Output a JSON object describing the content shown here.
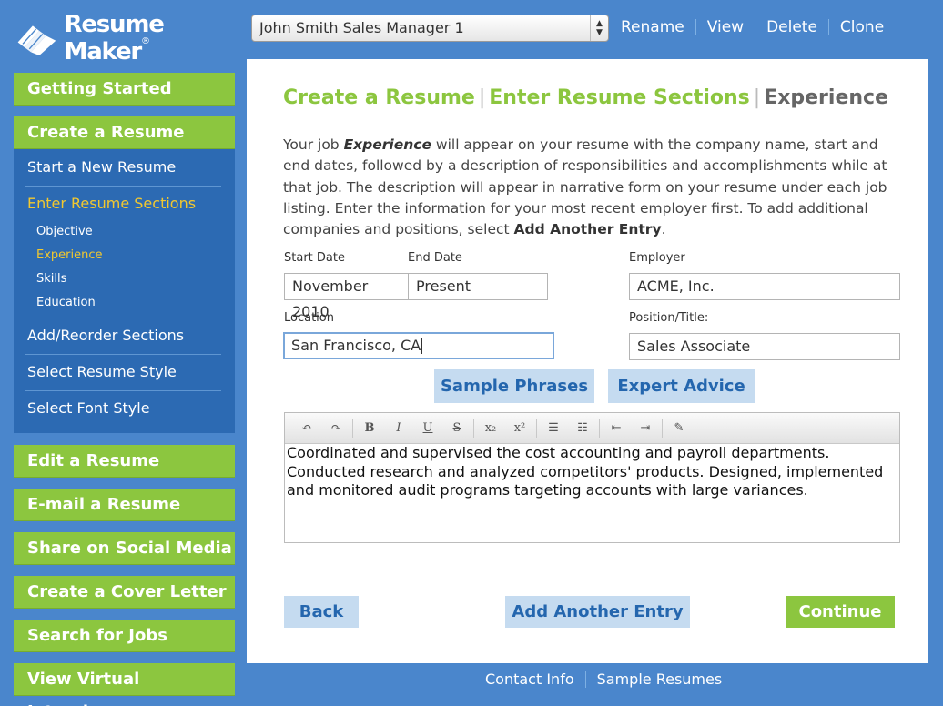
{
  "logo": {
    "text": "Resume Maker",
    "reg": "®"
  },
  "resume_select": {
    "value": "John Smith Sales Manager 1"
  },
  "top_links": [
    "Rename",
    "View",
    "Delete",
    "Clone"
  ],
  "sidebar": {
    "getting_started": "Getting Started",
    "create_resume": "Create a Resume",
    "start_new": "Start a New Resume",
    "enter_sections": "Enter Resume Sections",
    "sub_items": [
      "Objective",
      "Experience",
      "Skills",
      "Education"
    ],
    "add_reorder": "Add/Reorder Sections",
    "select_style": "Select Resume Style",
    "select_font": "Select Font Style",
    "edit_resume": "Edit a Resume",
    "email_resume": "E-mail a Resume",
    "share_social": "Share on Social Media",
    "cover_letter": "Create a Cover Letter",
    "search_jobs": "Search for Jobs",
    "virtual_interviews": "View Virtual Interviews"
  },
  "breadcrumb": {
    "a": "Create a Resume",
    "b": "Enter Resume Sections",
    "c": "Experience"
  },
  "intro": {
    "p1": "Your job ",
    "em": "Experience",
    "p2": " will appear on your resume with the company name, start and end dates, followed by a description of responsibilities and accomplishments while at that job. The description will appear in narrative form on your resume under each job listing. Enter the information for your most recent employer first. To add additional companies and positions, select ",
    "strong": "Add Another Entry",
    "p3": "."
  },
  "form": {
    "start_label": "Start Date",
    "start_value": "November 2010",
    "end_label": "End Date",
    "end_value": "Present",
    "employer_label": "Employer",
    "employer_value": "ACME, Inc.",
    "location_label": "Location",
    "location_value": "San Francisco, CA",
    "position_label": "Position/Title:",
    "position_value": "Sales Associate"
  },
  "buttons": {
    "sample_phrases": "Sample Phrases",
    "expert_advice": "Expert Advice",
    "back": "Back",
    "add_another": "Add Another Entry",
    "continue": "Continue"
  },
  "editor": {
    "toolbar": [
      "undo-icon",
      "redo-icon",
      "bold-icon",
      "italic-icon",
      "underline-icon",
      "strikethrough-icon",
      "subscript-icon",
      "superscript-icon",
      "numbered-list-icon",
      "bullet-list-icon",
      "outdent-icon",
      "indent-icon",
      "clear-format-icon"
    ],
    "text": "Coordinated and supervised the cost accounting and payroll departments. Conducted research and analyzed competitors' products. Designed, implemented and monitored audit programs targeting accounts with large variances."
  },
  "footer_links": [
    "Contact Info",
    "Sample Resumes"
  ],
  "colors": {
    "brand_blue": "#4a86cc",
    "nav_blue": "#2c6ab3",
    "green": "#8cc63f",
    "active_yellow": "#f2c82f",
    "light_button": "#c5dbf0"
  }
}
